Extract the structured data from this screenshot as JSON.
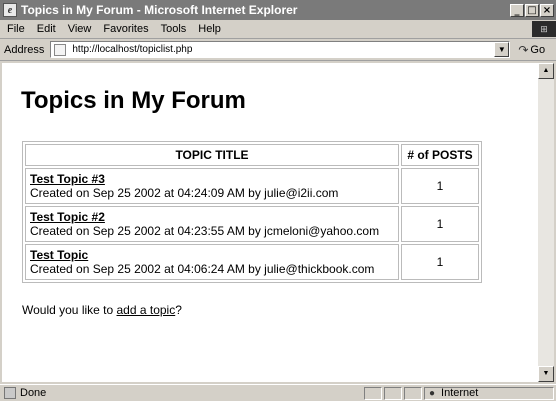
{
  "window": {
    "title": "Topics in My Forum - Microsoft Internet Explorer",
    "min_glyph": "_",
    "max_glyph": "□",
    "close_glyph": "×"
  },
  "menu": {
    "items": [
      "File",
      "Edit",
      "View",
      "Favorites",
      "Tools",
      "Help"
    ]
  },
  "address": {
    "label": "Address",
    "url": "http://localhost/topiclist.php",
    "dropdown_glyph": "▼",
    "go_label": "Go",
    "go_glyph": "↷"
  },
  "page": {
    "heading": "Topics in My Forum",
    "table": {
      "headers": [
        "TOPIC TITLE",
        "# of POSTS"
      ],
      "rows": [
        {
          "title": "Test Topic #3",
          "meta": "Created on Sep 25 2002 at 04:24:09 AM by julie@i2ii.com",
          "posts": "1"
        },
        {
          "title": "Test Topic #2",
          "meta": "Created on Sep 25 2002 at 04:23:55 AM by jcmeloni@yahoo.com",
          "posts": "1"
        },
        {
          "title": "Test Topic",
          "meta": "Created on Sep 25 2002 at 04:06:24 AM by julie@thickbook.com",
          "posts": "1"
        }
      ]
    },
    "footer": {
      "before": "Would you like to ",
      "link": "add a topic",
      "after": "?"
    }
  },
  "scrollbar": {
    "up_glyph": "▲",
    "down_glyph": "▼"
  },
  "status": {
    "text": "Done",
    "zone": "Internet",
    "zone_glyph": "●"
  },
  "icons": {
    "ie": "ie-logo-icon",
    "windows": "windows-logo-icon",
    "page": "page-icon",
    "status": "status-page-icon",
    "zone": "internet-zone-icon"
  },
  "colors": {
    "titlebar": "#7a7a7a",
    "chrome": "#d4d0c8",
    "content": "#ffffff",
    "text": "#000000"
  }
}
